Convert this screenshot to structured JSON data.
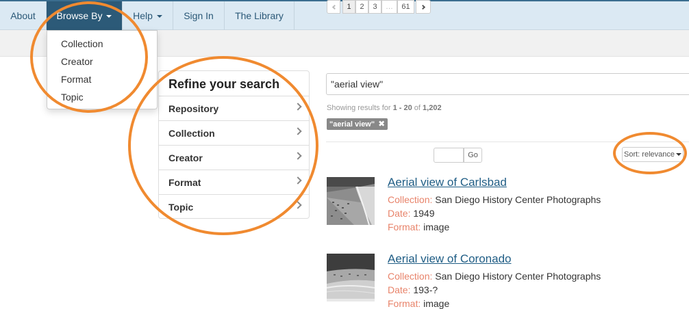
{
  "nav": {
    "items": [
      {
        "label": "About"
      },
      {
        "label": "Browse By"
      },
      {
        "label": "Help"
      },
      {
        "label": "Sign In"
      },
      {
        "label": "The Library"
      }
    ]
  },
  "browse_menu": {
    "items": [
      "Collection",
      "Creator",
      "Format",
      "Topic"
    ]
  },
  "refine": {
    "title": "Refine your search",
    "facets": [
      "Repository",
      "Collection",
      "Creator",
      "Format",
      "Topic"
    ]
  },
  "search": {
    "value": "\"aerial view\"",
    "showing_prefix": "Showing results for ",
    "range": "1 - 20",
    "of_text": " of ",
    "total": "1,202",
    "tag": "\"aerial view\""
  },
  "pagination": {
    "pages": [
      "1",
      "2",
      "3",
      "…",
      "61"
    ],
    "go_label": "Go",
    "sort_label": "Sort: relevance"
  },
  "results": [
    {
      "title": "Aerial view of Carlsbad",
      "collection_label": "Collection:",
      "collection": "San Diego History Center Photographs",
      "date_label": "Date:",
      "date": "1949",
      "format_label": "Format:",
      "format": "image"
    },
    {
      "title": "Aerial view of Coronado",
      "collection_label": "Collection:",
      "collection": "San Diego History Center Photographs",
      "date_label": "Date:",
      "date": "193-?",
      "format_label": "Format:",
      "format": "image"
    }
  ],
  "colors": {
    "nav_bg": "#dbe9f3",
    "nav_active": "#2c5a78",
    "link": "#1f5d85",
    "field_label": "#e8836a",
    "annotation": "#f08a30"
  }
}
